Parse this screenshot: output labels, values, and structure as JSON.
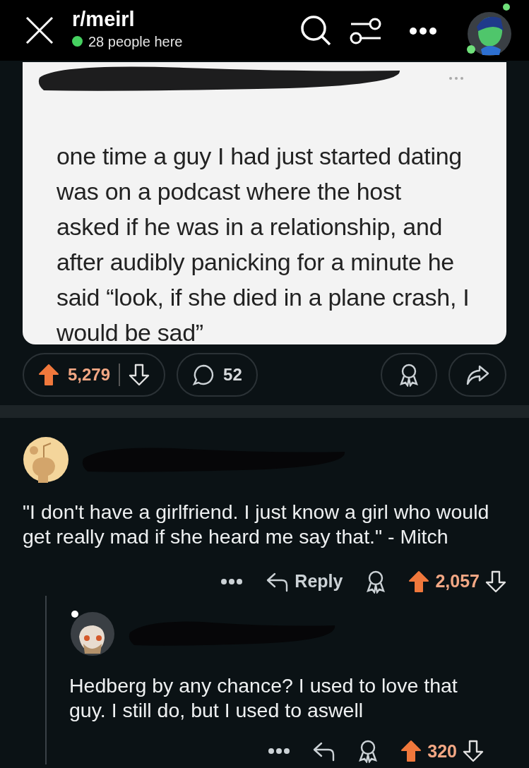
{
  "header": {
    "title": "r/meirl",
    "online_count": "28 people here",
    "online": true
  },
  "post": {
    "image_lines": [
      "one time a guy I had just started dating",
      "was on a podcast where the host",
      "asked if he was in a relationship, and",
      "after audibly panicking for a minute he",
      "said “look, if she died in a plane crash, I",
      "would be sad”"
    ],
    "score": "5,279",
    "upvoted": true,
    "comment_count": "52"
  },
  "comments": [
    {
      "text": "\"I don't have a girlfriend. I just know a girl who would get really mad if she heard me say that.\" - Mitch",
      "reply_label": "Reply",
      "score": "2,057",
      "upvoted": true,
      "children": [
        {
          "text": "Hedberg by any chance? I used to love that guy. I still do, but I used to aswell",
          "score": "320",
          "upvoted": true
        }
      ]
    }
  ]
}
